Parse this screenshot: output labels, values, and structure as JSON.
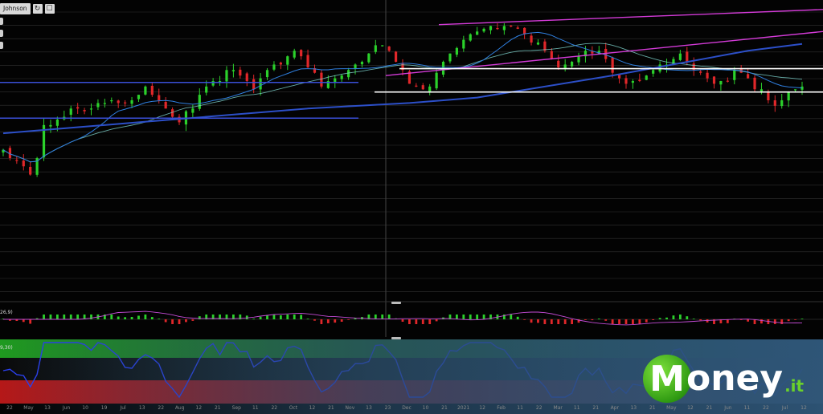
{
  "toolbar": {
    "symbol_label": "Johnson",
    "refresh_icon": "refresh-icon",
    "settings_icon": "checkbox-icon"
  },
  "indicators": {
    "macd_label": "26,9)",
    "osc_label": "9,30)"
  },
  "x_axis_ticks": [
    "22",
    "May",
    "13",
    "Jun",
    "10",
    "19",
    "Jul",
    "13",
    "22",
    "Aug",
    "12",
    "21",
    "Sep",
    "11",
    "22",
    "Oct",
    "12",
    "21",
    "Nov",
    "13",
    "23",
    "Dec",
    "10",
    "21",
    "2021",
    "12",
    "Feb",
    "11",
    "22",
    "Mar",
    "11",
    "21",
    "Apr",
    "13",
    "21",
    "May",
    "12",
    "21",
    "Jun",
    "11",
    "22",
    "Jul",
    "12"
  ],
  "logo": {
    "mark": "M",
    "text": "oney",
    "suffix": ".it"
  },
  "colors": {
    "bull": "#2bd12b",
    "bear": "#e0272a",
    "sma_fast": "#2f7fe0",
    "sma_slow": "#7fd6d0",
    "sma_long": "#2c4fc8",
    "channel": "#d43bd8",
    "support": "#ffffff",
    "range": "#3a4fd8",
    "osc_line": "#2a3ff0",
    "osc_top": "#1f8f1f",
    "osc_bottom": "#b51818"
  },
  "chart_data": {
    "type": "candlestick",
    "series": [
      {
        "name": "",
        "values": [
          197,
          194,
          193,
          191,
          188,
          194,
          206,
          206,
          208,
          209,
          212,
          212,
          211,
          212,
          214,
          214,
          215,
          214,
          214,
          215,
          217,
          220,
          217,
          215,
          212,
          209,
          207,
          211,
          212,
          217,
          220,
          222,
          222,
          226,
          226,
          224,
          222,
          219,
          223,
          226,
          228,
          228,
          231,
          233,
          231,
          227,
          225,
          220,
          222,
          223,
          224,
          226,
          228,
          229,
          232,
          235,
          235,
          233,
          229,
          226,
          221,
          220,
          219,
          220,
          225,
          229,
          232,
          234,
          237,
          239,
          240,
          241,
          242,
          241,
          242,
          242,
          241,
          239,
          236,
          236,
          233,
          230,
          227,
          228,
          229,
          231,
          233,
          232,
          233,
          230,
          225,
          223,
          221,
          222,
          222,
          224,
          226,
          228,
          228,
          230,
          232,
          229,
          226,
          225,
          223,
          221,
          222,
          222,
          226,
          225,
          223,
          219,
          219,
          215,
          213,
          215,
          218,
          219,
          220
        ]
      }
    ]
  }
}
